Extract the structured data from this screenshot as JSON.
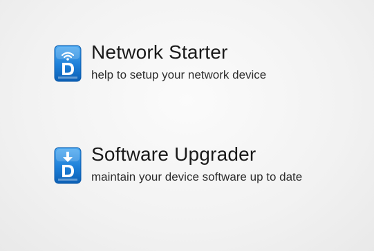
{
  "menu": {
    "items": [
      {
        "title": "Network Starter",
        "subtitle": "help to setup your network device",
        "icon": "network-starter-icon"
      },
      {
        "title": "Software Upgrader",
        "subtitle": "maintain your device software up to date",
        "icon": "software-upgrader-icon"
      }
    ]
  },
  "colors": {
    "background": "#f2f2f2",
    "icon_blue": "#1e7fd6",
    "title_text": "#1a1a1a"
  }
}
